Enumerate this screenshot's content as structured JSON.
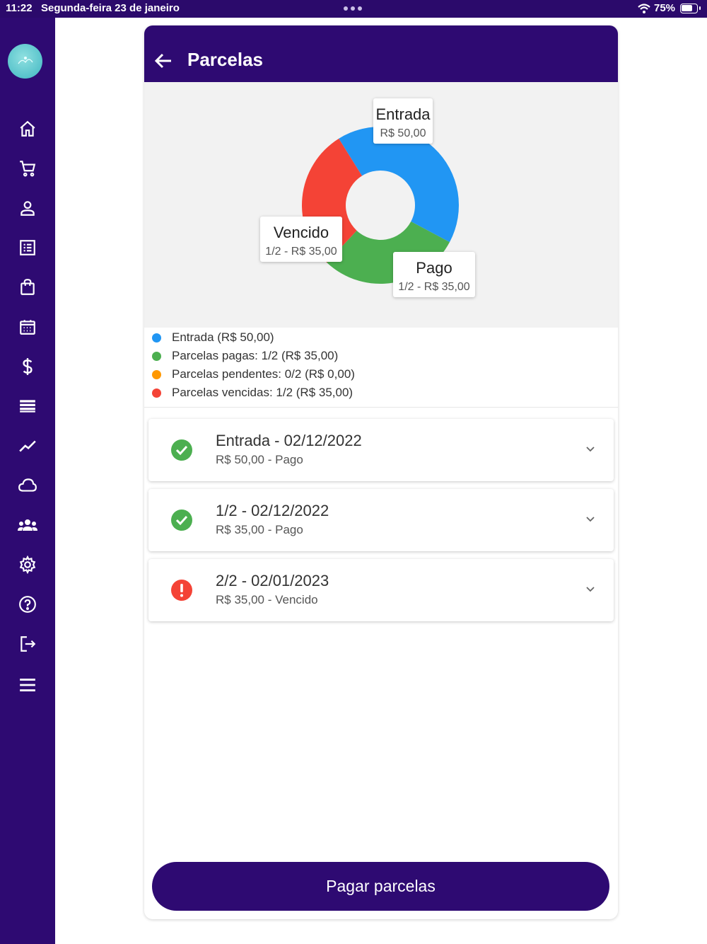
{
  "status_bar": {
    "time": "11:22",
    "date": "Segunda-feira 23 de janeiro",
    "battery": "75%"
  },
  "sidebar": {
    "items": [
      {
        "icon": "home-icon"
      },
      {
        "icon": "cart-icon"
      },
      {
        "icon": "user-icon"
      },
      {
        "icon": "list-icon"
      },
      {
        "icon": "bag-icon"
      },
      {
        "icon": "calendar-icon"
      },
      {
        "icon": "dollar-icon"
      },
      {
        "icon": "bars-icon"
      },
      {
        "icon": "trend-icon"
      },
      {
        "icon": "cloud-icon"
      },
      {
        "icon": "group-icon"
      },
      {
        "icon": "gear-icon"
      },
      {
        "icon": "help-icon"
      },
      {
        "icon": "logout-icon"
      },
      {
        "icon": "menu-icon"
      }
    ]
  },
  "header": {
    "title": "Parcelas"
  },
  "chart_data": {
    "type": "pie",
    "donut": true,
    "slices": [
      {
        "name": "Entrada",
        "value": 50,
        "label": "R$ 50,00",
        "color": "#2196f3"
      },
      {
        "name": "Pago",
        "value": 35,
        "label": "1/2 - R$ 35,00",
        "color": "#4caf50"
      },
      {
        "name": "Vencido",
        "value": 35,
        "label": "1/2 - R$ 35,00",
        "color": "#f44336"
      }
    ]
  },
  "legend": [
    {
      "text": "Entrada (R$ 50,00)",
      "color": "#2196f3"
    },
    {
      "text": "Parcelas pagas: 1/2 (R$ 35,00)",
      "color": "#4caf50"
    },
    {
      "text": "Parcelas pendentes: 0/2 (R$ 0,00)",
      "color": "#ff9800"
    },
    {
      "text": "Parcelas vencidas: 1/2 (R$ 35,00)",
      "color": "#f44336"
    }
  ],
  "installments": [
    {
      "title": "Entrada - 02/12/2022",
      "subtitle": "R$ 50,00 - Pago",
      "status": "paid"
    },
    {
      "title": "1/2 - 02/12/2022",
      "subtitle": "R$ 35,00 - Pago",
      "status": "paid"
    },
    {
      "title": "2/2 - 02/01/2023",
      "subtitle": "R$ 35,00 - Vencido",
      "status": "overdue"
    }
  ],
  "pay_button": "Pagar parcelas",
  "colors": {
    "primary": "#2e0a72",
    "paid": "#4caf50",
    "overdue": "#f44336"
  }
}
